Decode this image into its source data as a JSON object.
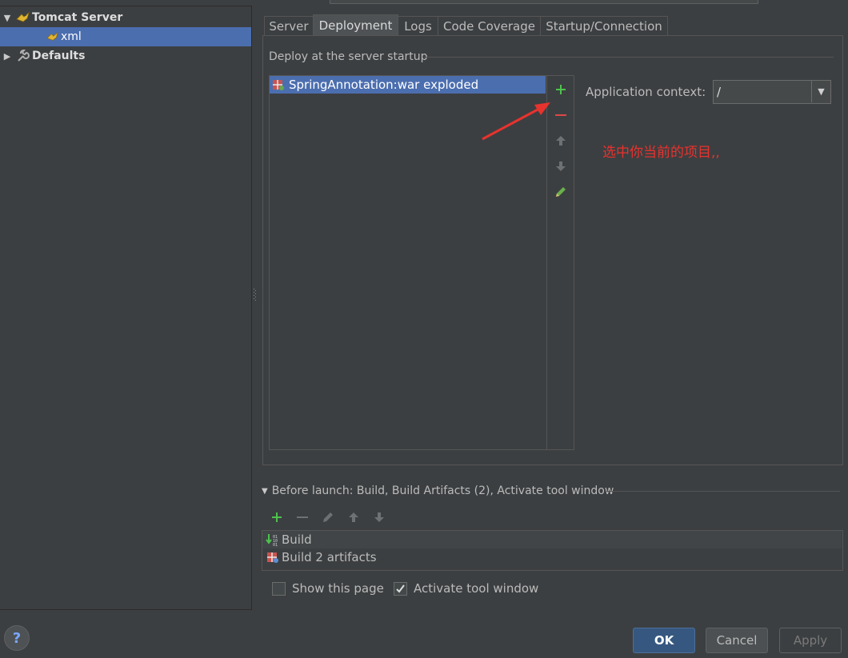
{
  "tree": {
    "items": [
      {
        "label": "Tomcat Server",
        "expanded": true,
        "icon": "tomcat-icon"
      },
      {
        "label": "xml",
        "selected": true,
        "icon": "tomcat-icon"
      },
      {
        "label": "Defaults",
        "expanded": false,
        "icon": "wrench-icon"
      }
    ]
  },
  "tabs": [
    {
      "label": "Server"
    },
    {
      "label": "Deployment",
      "active": true
    },
    {
      "label": "Logs"
    },
    {
      "label": "Code Coverage"
    },
    {
      "label": "Startup/Connection"
    }
  ],
  "deployment": {
    "section_title": "Deploy at the server startup",
    "items": [
      {
        "label": "SpringAnnotation:war exploded",
        "icon": "artifact-icon"
      }
    ],
    "toolbar": [
      "add-icon",
      "remove-icon",
      "move-up-icon",
      "move-down-icon",
      "edit-icon"
    ],
    "context_label": "Application context:",
    "context_value": "/"
  },
  "annotation": {
    "text": "选中你当前的项目,,",
    "color": "#e8322e"
  },
  "before_launch": {
    "header": "Before launch: Build, Build Artifacts (2), Activate tool window",
    "items": [
      {
        "label": "Build",
        "icon": "build-icon"
      },
      {
        "label": "Build 2 artifacts",
        "icon": "artifact-icon"
      }
    ]
  },
  "options": {
    "show_this_page": {
      "label": "Show this page",
      "checked": false
    },
    "activate_tool_window": {
      "label": "Activate tool window",
      "checked": true
    }
  },
  "buttons": {
    "help": "?",
    "ok": "OK",
    "cancel": "Cancel",
    "apply": "Apply"
  },
  "colors": {
    "selection": "#4b6eaf",
    "background": "#3c3f41",
    "add_green": "#4ec24e",
    "remove_red": "#e04646"
  }
}
